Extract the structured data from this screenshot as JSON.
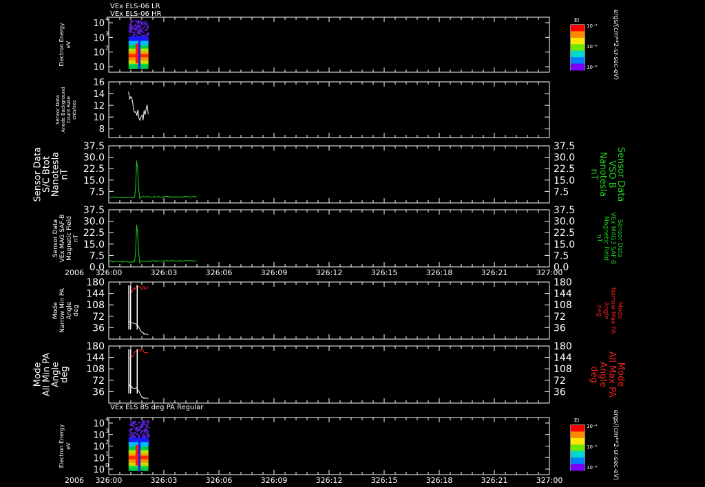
{
  "colors": {
    "background": "#000000",
    "foreground": "#ffffff",
    "green": "#1fd21f",
    "red": "#e8231c",
    "white": "#ffffff"
  },
  "chart_data": [
    {
      "type": "heatmap",
      "titles": [
        "VEx ELS-06 LR",
        "VEx ELS-06 HR"
      ],
      "ylabel": [
        "Electron Energy",
        "eV"
      ],
      "y_ticks": [
        {
          "label": "10",
          "sup": "4"
        },
        {
          "label": "10",
          "sup": "3"
        },
        {
          "label": "10",
          "sup": "2"
        },
        {
          "label": "10",
          "sup": ""
        }
      ],
      "colorbar": {
        "title": "El",
        "ticks": [
          "10⁻⁴",
          "10⁻⁶",
          "10⁻⁸"
        ]
      },
      "right_label": "ergs/(cm**2-sr-sec-eV)",
      "data_x": [
        326.045,
        326.09
      ]
    },
    {
      "type": "line",
      "ylabel": [
        "Sensor Data",
        "Anode Background",
        "Count Rate",
        "cnts/sec"
      ],
      "y_ticks": [
        "16",
        "14",
        "12",
        "10",
        "8"
      ],
      "ylim": [
        6.5,
        16
      ],
      "series": [
        {
          "color": "white",
          "x": [
            326.045,
            326.055,
            326.065,
            326.075,
            326.085,
            326.09
          ],
          "values": [
            13.6,
            11.4,
            10.1,
            10.3,
            10.8,
            10.4
          ]
        }
      ]
    },
    {
      "type": "line",
      "ylabel": [
        "Sensor Data",
        "S/C Btot",
        "Nanotesla",
        "nT"
      ],
      "right_ylabel": [
        "Sensor Data",
        "VSO B",
        "Nanotesla",
        "nT"
      ],
      "y_ticks": [
        "37.5",
        "30.0",
        "22.5",
        "15.0",
        "7.5"
      ],
      "ylim": [
        0,
        37.5
      ],
      "series": [
        {
          "color": "green",
          "x": [
            326.0,
            326.06,
            326.064,
            326.067,
            326.07,
            326.075,
            326.1,
            326.2
          ],
          "values": [
            3.9,
            3.4,
            33.0,
            12.0,
            3.0,
            4.0,
            4.0,
            4.0
          ]
        }
      ]
    },
    {
      "type": "line",
      "ylabel": [
        "Sensor Data",
        "VEx MAG SAF-B",
        "Magnetic Field",
        "nT"
      ],
      "right_ylabel": [
        "Sensor Data",
        "VEx MAG3 SAF-B",
        "Magnetic Field",
        "nT"
      ],
      "y_ticks": [
        "37.5",
        "30.0",
        "22.5",
        "15.0",
        "7.5",
        "0.0"
      ],
      "ylim": [
        0,
        37.5
      ],
      "series": [
        {
          "color": "green",
          "x": [
            326.0,
            326.06,
            326.064,
            326.067,
            326.07,
            326.075,
            326.1,
            326.2
          ],
          "values": [
            3.6,
            3.2,
            32.5,
            12.0,
            2.6,
            3.8,
            3.9,
            3.9
          ]
        }
      ]
    },
    {
      "type": "line",
      "ylabel": [
        "Mode",
        "Narrow Min PA",
        "Angle",
        "deg"
      ],
      "right_ylabel": [
        "Mode",
        "Narrow Max PA",
        "Angle",
        "deg"
      ],
      "y_ticks": [
        "180",
        "144",
        "108",
        "72",
        "36"
      ],
      "ylim": [
        0,
        180
      ],
      "series": [
        {
          "color": "white",
          "x": [
            326.045,
            326.05,
            326.065,
            326.075,
            326.09
          ],
          "values": [
            60,
            52,
            45,
            20,
            12
          ]
        },
        {
          "color": "red",
          "x": [
            326.045,
            326.055,
            326.065,
            326.075,
            326.09
          ],
          "values": [
            145,
            155,
            168,
            160,
            165
          ]
        }
      ]
    },
    {
      "type": "line",
      "ylabel": [
        "Mode",
        "All Min PA",
        "Angle",
        "deg"
      ],
      "right_ylabel": [
        "Mode",
        "All Max PA",
        "Angle",
        "deg"
      ],
      "y_ticks": [
        "180",
        "144",
        "108",
        "72",
        "36"
      ],
      "ylim": [
        0,
        180
      ],
      "series": [
        {
          "color": "white",
          "x": [
            326.045,
            326.05,
            326.065,
            326.075,
            326.09
          ],
          "values": [
            60,
            50,
            45,
            18,
            12
          ]
        },
        {
          "color": "red",
          "x": [
            326.045,
            326.055,
            326.065,
            326.075,
            326.09
          ],
          "values": [
            140,
            150,
            170,
            165,
            160
          ]
        }
      ]
    },
    {
      "type": "heatmap",
      "titles": [
        "VEx ELS 85 deg PA Regular"
      ],
      "ylabel": [
        "Electron Energy",
        "eV"
      ],
      "y_ticks": [
        {
          "label": "10",
          "sup": "4"
        },
        {
          "label": "10",
          "sup": "3"
        },
        {
          "label": "10",
          "sup": "2"
        },
        {
          "label": "10",
          "sup": "1"
        },
        {
          "label": "10",
          "sup": "0"
        }
      ],
      "colorbar": {
        "title": "El",
        "ticks": [
          "10⁻⁴",
          "10⁻⁶",
          "10⁻⁸"
        ]
      },
      "right_label": "ergs/(cm**2-sr-sec-eV)",
      "data_x": [
        326.045,
        326.09
      ]
    }
  ],
  "x_axis": {
    "year": "2006",
    "xlim": [
      326.0,
      327.0
    ],
    "tick_labels": [
      "326:00",
      "326:03",
      "326:06",
      "326:09",
      "326:12",
      "326:15",
      "326:18",
      "326:21",
      "327:00"
    ]
  }
}
